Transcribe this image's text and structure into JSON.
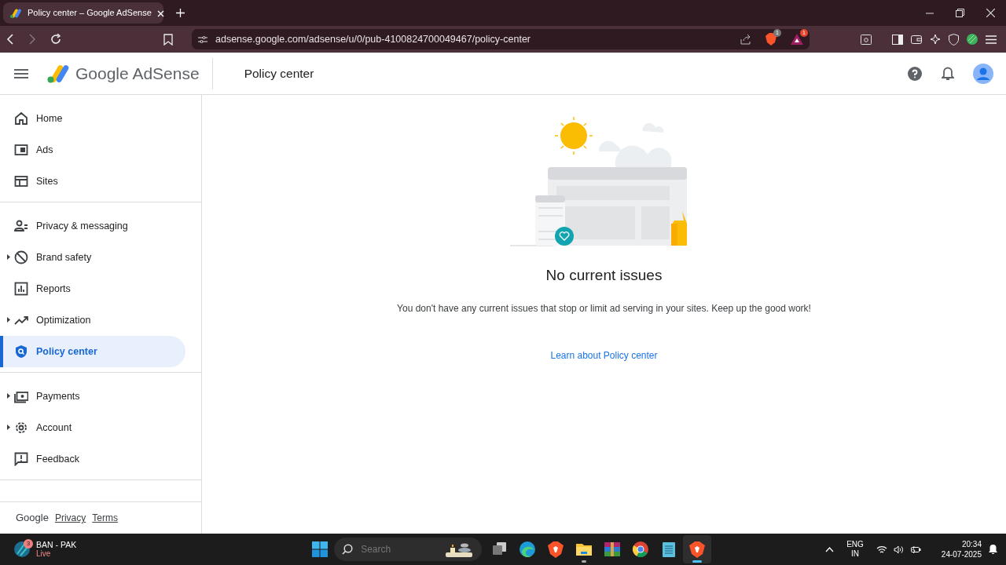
{
  "browser": {
    "tab": {
      "title": "Policy center – Google AdSense",
      "selected": true
    },
    "url": "adsense.google.com/adsense/u/0/pub-4100824700049467/policy-center",
    "shields_badge": "1",
    "rewards_badge": "1"
  },
  "app": {
    "brand": "Google AdSense",
    "page_title": "Policy center"
  },
  "sidebar": {
    "groups": [
      [
        {
          "label": "Home",
          "kind": "home",
          "expandable": false,
          "selected": false
        },
        {
          "label": "Ads",
          "kind": "ads",
          "expandable": false,
          "selected": false
        },
        {
          "label": "Sites",
          "kind": "sites",
          "expandable": false,
          "selected": false
        }
      ],
      [
        {
          "label": "Privacy & messaging",
          "kind": "privacy",
          "expandable": false,
          "selected": false
        },
        {
          "label": "Brand safety",
          "kind": "block",
          "expandable": true,
          "selected": false
        },
        {
          "label": "Reports",
          "kind": "reports",
          "expandable": false,
          "selected": false
        },
        {
          "label": "Optimization",
          "kind": "trend",
          "expandable": true,
          "selected": false
        },
        {
          "label": "Policy center",
          "kind": "shield",
          "expandable": false,
          "selected": true
        }
      ],
      [
        {
          "label": "Payments",
          "kind": "payments",
          "expandable": true,
          "selected": false
        },
        {
          "label": "Account",
          "kind": "gear",
          "expandable": true,
          "selected": false
        },
        {
          "label": "Feedback",
          "kind": "feedback",
          "expandable": false,
          "selected": false
        }
      ]
    ],
    "footer": {
      "brand": "Google",
      "links": [
        "Privacy",
        "Terms"
      ]
    }
  },
  "main": {
    "heading": "No current issues",
    "message": "You don't have any current issues that stop or limit ad serving in your sites. Keep up the good work!",
    "link": "Learn about Policy center"
  },
  "taskbar": {
    "widget": {
      "title": "BAN - PAK",
      "status": "Live",
      "badge": "3"
    },
    "search": {
      "placeholder": "Search"
    },
    "apps": [
      {
        "kind": "tasks",
        "running": false,
        "selected": false
      },
      {
        "kind": "edge",
        "running": false,
        "selected": false
      },
      {
        "kind": "brave",
        "running": false,
        "selected": false
      },
      {
        "kind": "folder",
        "running": true,
        "selected": false
      },
      {
        "kind": "archive",
        "running": false,
        "selected": false
      },
      {
        "kind": "chrome",
        "running": false,
        "selected": false
      },
      {
        "kind": "notepad",
        "running": false,
        "selected": false
      },
      {
        "kind": "brave",
        "running": true,
        "selected": true
      }
    ],
    "language": {
      "line1": "ENG",
      "line2": "IN"
    },
    "time": "20:34",
    "date": "24-07-2025"
  }
}
